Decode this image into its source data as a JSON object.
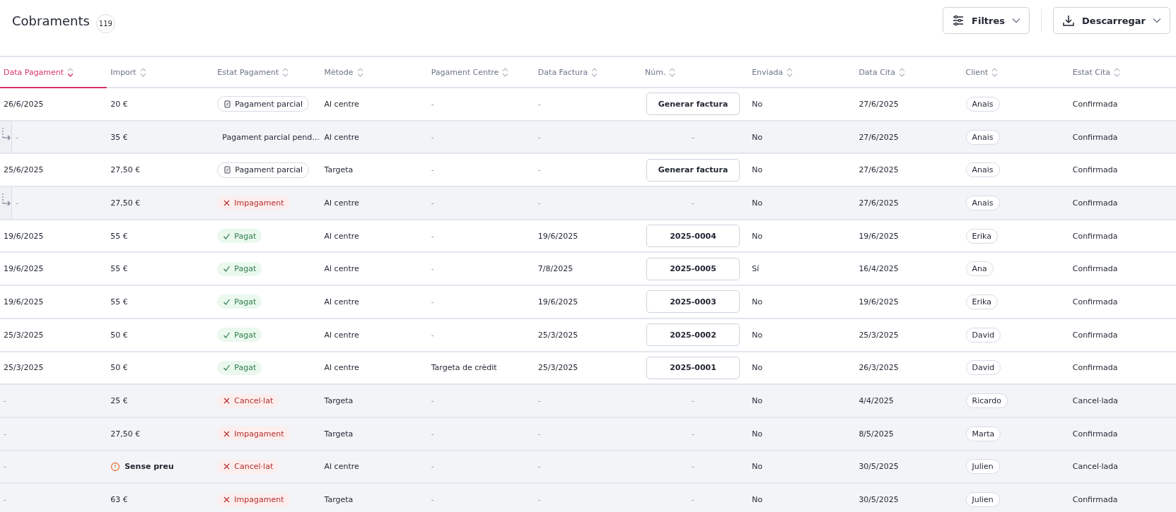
{
  "page": {
    "title": "Cobraments",
    "count": "119"
  },
  "toolbar": {
    "buttons": [
      {
        "kind": "filter",
        "label": "Filtres"
      },
      {
        "kind": "download",
        "label": "Descarregar"
      }
    ]
  },
  "table": {
    "columns": [
      {
        "label": "Data Pagament",
        "selected": true
      },
      {
        "label": "Import",
        "selected": false
      },
      {
        "label": "Estat Pagament",
        "selected": false
      },
      {
        "label": "Mètode",
        "selected": false
      },
      {
        "label": "Pagament Centre",
        "selected": false
      },
      {
        "label": "Data Factura",
        "selected": false
      },
      {
        "label": "Núm.",
        "selected": false
      },
      {
        "label": "Enviada",
        "selected": false
      },
      {
        "label": "Data Cita",
        "selected": false
      },
      {
        "label": "Client",
        "selected": false
      },
      {
        "label": "Estat Cita",
        "selected": false
      }
    ],
    "rows": [
      {
        "kind": "parent",
        "shaded": false,
        "date": "26/6/2025",
        "amount": {
          "kind": "value",
          "text": "20 €"
        },
        "status": {
          "kind": "partial",
          "text": "Pagament parcial"
        },
        "method": "Al centre",
        "centre": "-",
        "invoice_date": "-",
        "number": {
          "kind": "button",
          "text": "Generar factura"
        },
        "sent": "No",
        "appointment": "27/6/2025",
        "client": "Anais",
        "appointment_status": "Confirmada"
      },
      {
        "kind": "child",
        "shaded": true,
        "date": "-",
        "amount": {
          "kind": "value",
          "text": "35 €"
        },
        "status": {
          "kind": "pending",
          "text": "Pagament parcial pend..."
        },
        "method": "Al centre",
        "centre": "-",
        "invoice_date": "-",
        "number": {
          "kind": "text",
          "text": "-"
        },
        "sent": "No",
        "appointment": "27/6/2025",
        "client": "Anais",
        "appointment_status": "Confirmada"
      },
      {
        "kind": "parent",
        "shaded": false,
        "date": "25/6/2025",
        "amount": {
          "kind": "value",
          "text": "27,50 €"
        },
        "status": {
          "kind": "partial",
          "text": "Pagament parcial"
        },
        "method": "Targeta",
        "centre": "-",
        "invoice_date": "-",
        "number": {
          "kind": "button",
          "text": "Generar factura"
        },
        "sent": "No",
        "appointment": "27/6/2025",
        "client": "Anais",
        "appointment_status": "Confirmada"
      },
      {
        "kind": "child",
        "shaded": true,
        "date": "-",
        "amount": {
          "kind": "value",
          "text": "27,50 €"
        },
        "status": {
          "kind": "failed",
          "text": "Impagament"
        },
        "method": "Al centre",
        "centre": "-",
        "invoice_date": "-",
        "number": {
          "kind": "text",
          "text": "-"
        },
        "sent": "No",
        "appointment": "27/6/2025",
        "client": "Anais",
        "appointment_status": "Confirmada"
      },
      {
        "kind": "parent",
        "shaded": false,
        "date": "19/6/2025",
        "amount": {
          "kind": "value",
          "text": "55 €"
        },
        "status": {
          "kind": "paid",
          "text": "Pagat"
        },
        "method": "Al centre",
        "centre": "-",
        "invoice_date": "19/6/2025",
        "number": {
          "kind": "button",
          "text": "2025-0004"
        },
        "sent": "No",
        "appointment": "19/6/2025",
        "client": "Erika",
        "appointment_status": "Confirmada"
      },
      {
        "kind": "parent",
        "shaded": false,
        "date": "19/6/2025",
        "amount": {
          "kind": "value",
          "text": "55 €"
        },
        "status": {
          "kind": "paid",
          "text": "Pagat"
        },
        "method": "Al centre",
        "centre": "-",
        "invoice_date": "7/8/2025",
        "number": {
          "kind": "button",
          "text": "2025-0005"
        },
        "sent": "Sí",
        "appointment": "16/4/2025",
        "client": "Ana",
        "appointment_status": "Confirmada"
      },
      {
        "kind": "parent",
        "shaded": false,
        "date": "19/6/2025",
        "amount": {
          "kind": "value",
          "text": "55 €"
        },
        "status": {
          "kind": "paid",
          "text": "Pagat"
        },
        "method": "Al centre",
        "centre": "-",
        "invoice_date": "19/6/2025",
        "number": {
          "kind": "button",
          "text": "2025-0003"
        },
        "sent": "No",
        "appointment": "19/6/2025",
        "client": "Erika",
        "appointment_status": "Confirmada"
      },
      {
        "kind": "parent",
        "shaded": false,
        "date": "25/3/2025",
        "amount": {
          "kind": "value",
          "text": "50 €"
        },
        "status": {
          "kind": "paid",
          "text": "Pagat"
        },
        "method": "Al centre",
        "centre": "-",
        "invoice_date": "25/3/2025",
        "number": {
          "kind": "button",
          "text": "2025-0002"
        },
        "sent": "No",
        "appointment": "25/3/2025",
        "client": "David",
        "appointment_status": "Confirmada"
      },
      {
        "kind": "parent",
        "shaded": false,
        "date": "25/3/2025",
        "amount": {
          "kind": "value",
          "text": "50 €"
        },
        "status": {
          "kind": "paid",
          "text": "Pagat"
        },
        "method": "Al centre",
        "centre": "Targeta de crèdit",
        "invoice_date": "25/3/2025",
        "number": {
          "kind": "button",
          "text": "2025-0001"
        },
        "sent": "No",
        "appointment": "26/3/2025",
        "client": "David",
        "appointment_status": "Confirmada"
      },
      {
        "kind": "parent",
        "shaded": true,
        "date": "-",
        "amount": {
          "kind": "value",
          "text": "25 €"
        },
        "status": {
          "kind": "failed",
          "text": "Cancel·lat"
        },
        "method": "Targeta",
        "centre": "-",
        "invoice_date": "-",
        "number": {
          "kind": "text",
          "text": "-"
        },
        "sent": "No",
        "appointment": "4/4/2025",
        "client": "Ricardo",
        "appointment_status": "Cancel·lada"
      },
      {
        "kind": "parent",
        "shaded": true,
        "date": "-",
        "amount": {
          "kind": "value",
          "text": "27,50 €"
        },
        "status": {
          "kind": "failed",
          "text": "Impagament"
        },
        "method": "Targeta",
        "centre": "-",
        "invoice_date": "-",
        "number": {
          "kind": "text",
          "text": "-"
        },
        "sent": "No",
        "appointment": "8/5/2025",
        "client": "Marta",
        "appointment_status": "Confirmada"
      },
      {
        "kind": "parent",
        "shaded": true,
        "date": "-",
        "amount": {
          "kind": "warning",
          "text": "Sense preu"
        },
        "status": {
          "kind": "failed",
          "text": "Cancel·lat"
        },
        "method": "Al centre",
        "centre": "-",
        "invoice_date": "-",
        "number": {
          "kind": "text",
          "text": "-"
        },
        "sent": "No",
        "appointment": "30/5/2025",
        "client": "Julien",
        "appointment_status": "Cancel·lada"
      },
      {
        "kind": "parent",
        "shaded": true,
        "date": "-",
        "amount": {
          "kind": "value",
          "text": "63 €"
        },
        "status": {
          "kind": "failed",
          "text": "Impagament"
        },
        "method": "Targeta",
        "centre": "-",
        "invoice_date": "-",
        "number": {
          "kind": "text",
          "text": "-"
        },
        "sent": "No",
        "appointment": "30/5/2025",
        "client": "Julien",
        "appointment_status": "Confirmada"
      }
    ]
  }
}
